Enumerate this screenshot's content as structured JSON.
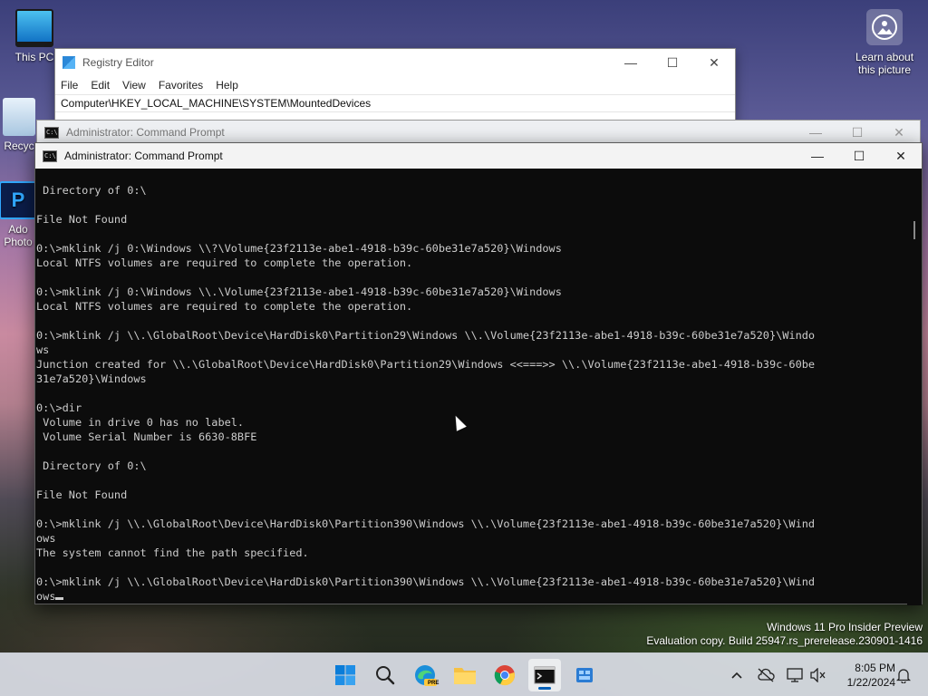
{
  "desktop": {
    "icons": [
      {
        "label": "This PC"
      },
      {
        "label": "Recyc"
      },
      {
        "label": "Ado Photo"
      }
    ],
    "learn_picture": {
      "line1": "Learn about",
      "line2": "this picture"
    },
    "watermark": {
      "line1": "Windows 11 Pro Insider Preview",
      "line2": "Evaluation copy. Build 25947.rs_prerelease.230901-1416"
    }
  },
  "regedit": {
    "title": "Registry Editor",
    "menu": [
      "File",
      "Edit",
      "View",
      "Favorites",
      "Help"
    ],
    "address": "Computer\\HKEY_LOCAL_MACHINE\\SYSTEM\\MountedDevices",
    "controls": {
      "minimize": "—",
      "maximize": "☐",
      "close": "✕"
    }
  },
  "cmd_back": {
    "title": "Administrator: Command Prompt",
    "controls": {
      "minimize": "—",
      "maximize": "☐",
      "close": "✕"
    }
  },
  "cmd": {
    "title": "Administrator: Command Prompt",
    "icon_text": "C:\\",
    "controls": {
      "minimize": "—",
      "maximize": "☐",
      "close": "✕"
    },
    "lines": [
      " Directory of 0:\\",
      "",
      "File Not Found",
      "",
      "0:\\>mklink /j 0:\\Windows \\\\?\\Volume{23f2113e-abe1-4918-b39c-60be31e7a520}\\Windows",
      "Local NTFS volumes are required to complete the operation.",
      "",
      "0:\\>mklink /j 0:\\Windows \\\\.\\Volume{23f2113e-abe1-4918-b39c-60be31e7a520}\\Windows",
      "Local NTFS volumes are required to complete the operation.",
      "",
      "0:\\>mklink /j \\\\.\\GlobalRoot\\Device\\HardDisk0\\Partition29\\Windows \\\\.\\Volume{23f2113e-abe1-4918-b39c-60be31e7a520}\\Windo",
      "ws",
      "Junction created for \\\\.\\GlobalRoot\\Device\\HardDisk0\\Partition29\\Windows <<===>> \\\\.\\Volume{23f2113e-abe1-4918-b39c-60be",
      "31e7a520}\\Windows",
      "",
      "0:\\>dir",
      " Volume in drive 0 has no label.",
      " Volume Serial Number is 6630-8BFE",
      "",
      " Directory of 0:\\",
      "",
      "File Not Found",
      "",
      "0:\\>mklink /j \\\\.\\GlobalRoot\\Device\\HardDisk0\\Partition390\\Windows \\\\.\\Volume{23f2113e-abe1-4918-b39c-60be31e7a520}\\Wind",
      "ows",
      "The system cannot find the path specified.",
      "",
      "0:\\>mklink /j \\\\.\\GlobalRoot\\Device\\HardDisk0\\Partition390\\Windows \\\\.\\Volume{23f2113e-abe1-4918-b39c-60be31e7a520}\\Wind",
      "ows"
    ]
  },
  "taskbar": {
    "apps": [
      {
        "name": "start-icon"
      },
      {
        "name": "search-icon"
      },
      {
        "name": "edge-pre-icon",
        "badge": "PRE"
      },
      {
        "name": "file-explorer-icon"
      },
      {
        "name": "chrome-icon"
      },
      {
        "name": "terminal-icon"
      },
      {
        "name": "app-icon"
      }
    ],
    "clock": {
      "time": "8:05 PM",
      "date": "1/22/2024"
    }
  },
  "colors": {
    "console_bg": "#0c0c0c",
    "console_fg": "#cccccc",
    "accent": "#005fb8"
  }
}
